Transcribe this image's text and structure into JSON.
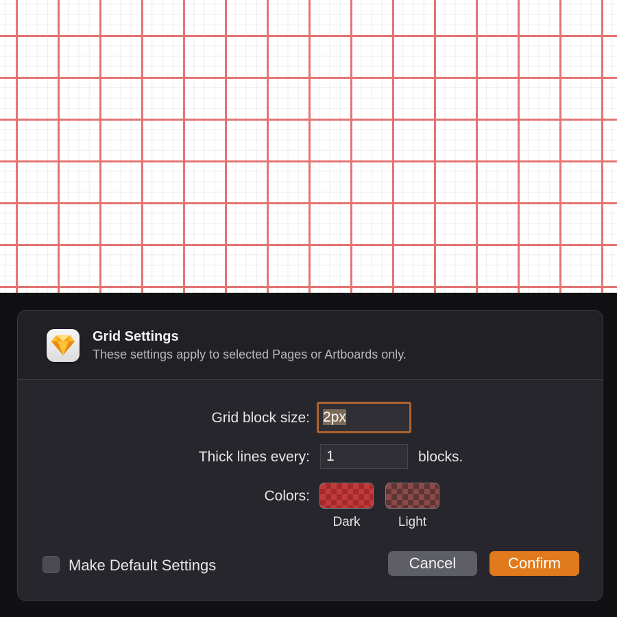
{
  "dialog": {
    "title": "Grid Settings",
    "subtitle": "These settings apply to selected Pages or Artboards only.",
    "app_icon": "sketch-diamond-icon"
  },
  "fields": {
    "block_size": {
      "label": "Grid block size:",
      "value": "2px"
    },
    "thick_lines": {
      "label": "Thick lines every:",
      "value": "1",
      "suffix": "blocks."
    }
  },
  "colors": {
    "label": "Colors:",
    "dark": {
      "caption": "Dark",
      "color": "#c33a3a"
    },
    "light": {
      "caption": "Light",
      "color": "#8a4a4a"
    }
  },
  "default_checkbox": {
    "label": "Make Default Settings",
    "checked": false
  },
  "buttons": {
    "cancel": "Cancel",
    "confirm": "Confirm"
  },
  "theme": {
    "grid_line_color": "#e57373",
    "accent": "#e07a1d",
    "dialog_bg": "#26262c"
  }
}
